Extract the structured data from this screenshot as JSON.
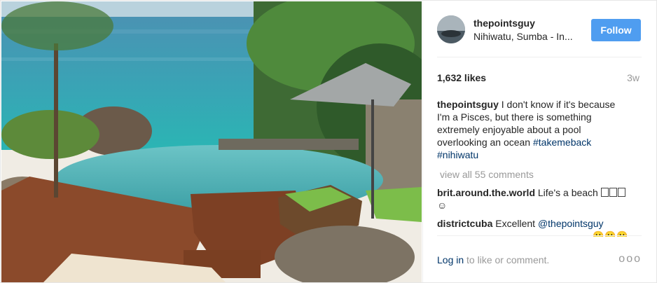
{
  "post": {
    "username": "thepointsguy",
    "location": "Nihiwatu, Sumba - In...",
    "follow_label": "Follow",
    "likes": "1,632 likes",
    "time": "3w",
    "caption": {
      "user": "thepointsguy",
      "text": " I don't know if it's because I'm a Pisces, but there is something extremely enjoyable about a pool overlooking an ocean ",
      "tags": [
        "#takemeback",
        "#nihiwatu"
      ]
    },
    "view_all": "view all 55 comments",
    "comments": [
      {
        "user": "brit.around.the.world",
        "text": " Life's a beach ",
        "trail": "☺"
      },
      {
        "user": "districtcuba",
        "text": " Excellent ",
        "mention": "@thepointsguy"
      }
    ],
    "partial_emoji": "🙂🙂🙂",
    "footer": {
      "login": "Log in",
      "login_suffix": " to like or comment.",
      "more": "ooo"
    }
  },
  "colors": {
    "follow": "#4f9df0",
    "link": "#003569",
    "muted": "#999999"
  },
  "icons": {
    "more": "more-options-icon"
  }
}
